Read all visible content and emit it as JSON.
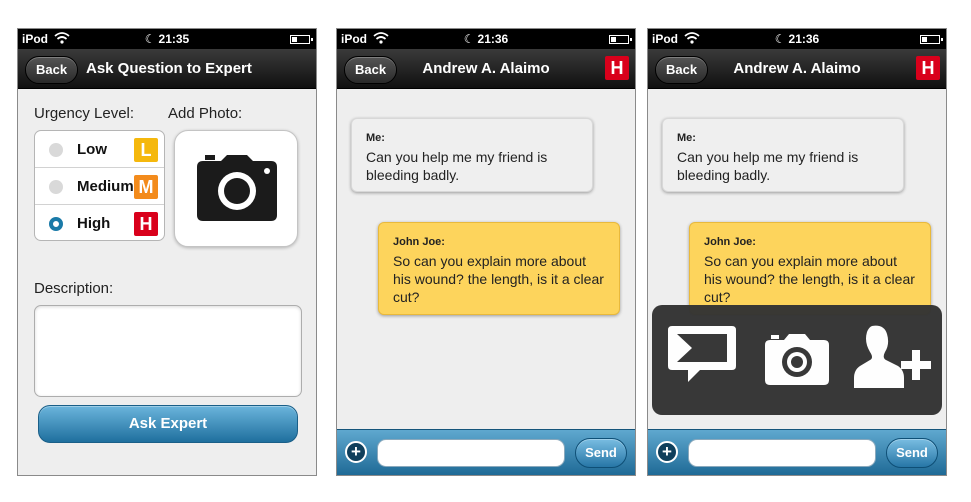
{
  "colors": {
    "high": "#d9001b",
    "medium": "#f38b1c",
    "low": "#f5b80d",
    "accent": "#1f6f9e",
    "expert_bubble": "#fdd45c"
  },
  "screens": [
    {
      "status": {
        "carrier": "iPod",
        "time": "21:35"
      },
      "nav": {
        "back": "Back",
        "title": "Ask Question to Expert"
      },
      "urgency_label": "Urgency Level:",
      "photo_label": "Add Photo:",
      "urgency_options": [
        {
          "label": "Low",
          "badge": "L",
          "selected": false
        },
        {
          "label": "Medium",
          "badge": "M",
          "selected": false
        },
        {
          "label": "High",
          "badge": "H",
          "selected": true
        }
      ],
      "description_label": "Description:",
      "description_value": "",
      "ask_button": "Ask Expert"
    },
    {
      "status": {
        "carrier": "iPod",
        "time": "21:36"
      },
      "nav": {
        "back": "Back",
        "title": "Andrew A. Alaimo",
        "badge": "H"
      },
      "messages": [
        {
          "sender": "Me:",
          "text": "Can you help me my friend is bleeding badly."
        },
        {
          "sender": "John Joe:",
          "text": "So can you explain more about his wound? the length, is it a clear cut?"
        }
      ],
      "input": {
        "value": "",
        "send": "Send"
      }
    },
    {
      "status": {
        "carrier": "iPod",
        "time": "21:36"
      },
      "nav": {
        "back": "Back",
        "title": "Andrew A. Alaimo",
        "badge": "H"
      },
      "messages": [
        {
          "sender": "Me:",
          "text": "Can you help me my friend is bleeding badly."
        },
        {
          "sender": "John Joe:",
          "text": "So can you explain more about his wound? the length, is it a clear cut?"
        }
      ],
      "actions": [
        {
          "icon": "video-message-icon"
        },
        {
          "icon": "camera-icon"
        },
        {
          "icon": "add-contact-icon"
        }
      ],
      "input": {
        "value": "",
        "send": "Send"
      }
    }
  ]
}
